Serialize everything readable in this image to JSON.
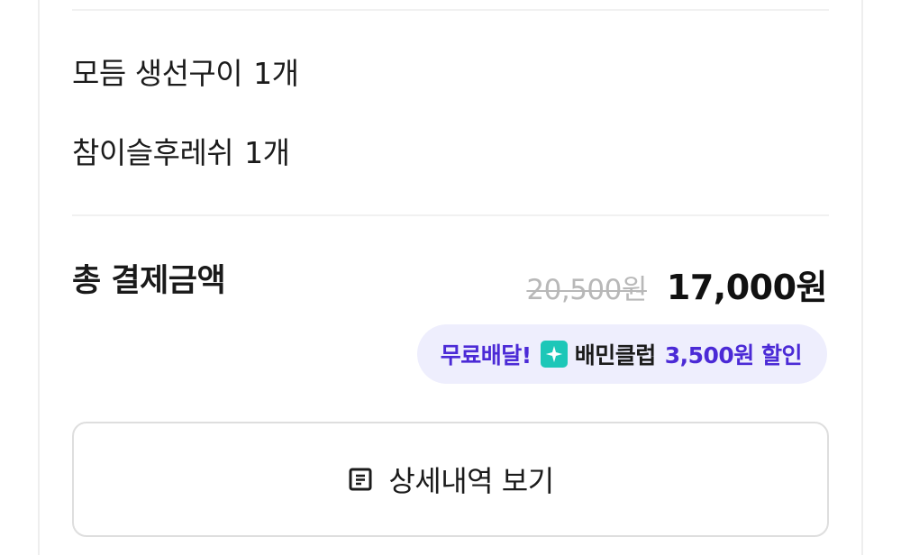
{
  "order_items": [
    {
      "name": "모듬 생선구이",
      "qty": "1개"
    },
    {
      "name": "참이슬후레쉬",
      "qty": "1개"
    }
  ],
  "total": {
    "label": "총 결제금액",
    "original_price": "20,500원",
    "final_price": "17,000원"
  },
  "promo": {
    "free_delivery": "무료배달!",
    "club_icon": "baemin-club-sparkle-icon",
    "club_name": "배민클럽",
    "discount": "3,500원 할인"
  },
  "detail_button": {
    "icon": "receipt-list-icon",
    "label": "상세내역 보기"
  },
  "colors": {
    "accent": "#4b2ad6",
    "badge_bg": "#eeeefd",
    "club_icon_bg": "#1dc7b8",
    "strike_price": "#b8b8b8"
  }
}
